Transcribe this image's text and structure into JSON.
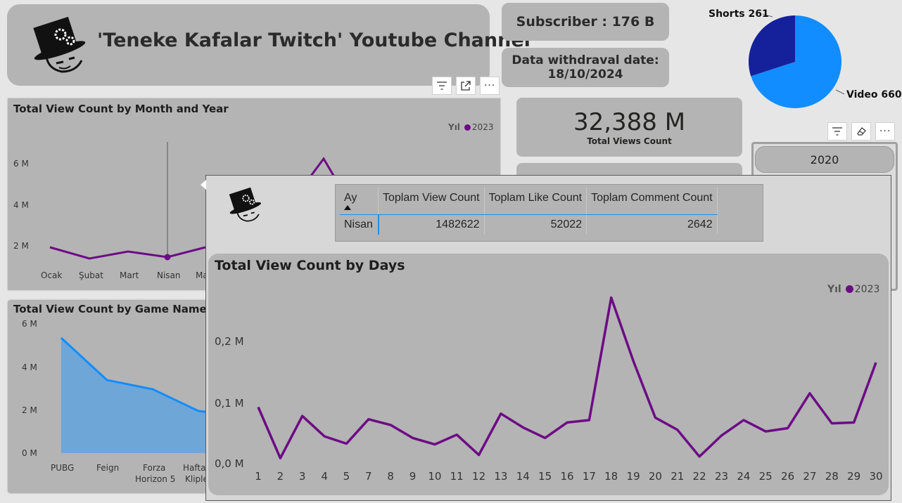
{
  "header": {
    "title": "'Teneke Kafalar Twitch' Youtube Channel",
    "logo_icon": "tin-head-gear-logo-icon"
  },
  "subscriber": {
    "label": "Subscriber : 176 B"
  },
  "withdraw": {
    "line1": "Data withdraval date:",
    "line2": "18/10/2024"
  },
  "total_views": {
    "value": "32,388 M",
    "label": "Total Views Count"
  },
  "pie": {
    "shorts_label": "Shorts 261",
    "video_label": "Video 660",
    "colors": {
      "shorts": "#14219a",
      "video": "#118dff"
    }
  },
  "slicer": {
    "year_value": "2020"
  },
  "visual_toolbar_icons": [
    "filter-icon",
    "focus-mode-icon",
    "more-options-icon",
    "eraser-icon"
  ],
  "month_chart": {
    "title": "Total View Count by Month and Year",
    "legend_title": "Yıl",
    "legend_item": "2023",
    "y_ticks": [
      "6 M",
      "4 M",
      "2 M"
    ],
    "x_ticks": [
      "Ocak",
      "Şubat",
      "Mart",
      "Nisan",
      "Ma"
    ]
  },
  "game_chart": {
    "title": "Total View Count by Game Name",
    "y_ticks": [
      "6 M",
      "4 M",
      "2 M",
      "0 M"
    ],
    "x_ticks": [
      "PUBG",
      "Feign",
      "Forza",
      "Horizon 5",
      "Haftar",
      "Kliple"
    ]
  },
  "tooltip": {
    "columns": [
      "Ay",
      "Toplam View Count",
      "Toplam Like Count",
      "Toplam Comment Count"
    ],
    "rows": [
      [
        "Nisan",
        "1482622",
        "52022",
        "2642"
      ]
    ]
  },
  "colors": {
    "line": "#6d0a85",
    "area_line": "#118dff",
    "area_fill": "#6fa6d8",
    "card_bg": "#b4b4b4",
    "page_bg": "#e6e6e6"
  },
  "chart_data": [
    {
      "type": "line",
      "title": "Total View Count by Days",
      "legend_title": "Yıl",
      "x": [
        1,
        2,
        3,
        4,
        5,
        6,
        7,
        8,
        9,
        10,
        11,
        12,
        13,
        14,
        15,
        16,
        17,
        18,
        19,
        20,
        21,
        22,
        23,
        24,
        25,
        26,
        27,
        28,
        29,
        30
      ],
      "x_tick_labels": [
        "1",
        "2",
        "3",
        "4",
        "5",
        "7",
        "8",
        "9",
        "10",
        "11",
        "12",
        "13",
        "14",
        "15",
        "16",
        "17",
        "18",
        "19",
        "20",
        "21",
        "22",
        "23",
        "24",
        "25",
        "26",
        "27",
        "28",
        "29",
        "30"
      ],
      "series": [
        {
          "name": "2023",
          "values": [
            0.068,
            0.005,
            0.057,
            0.032,
            0.023,
            0.053,
            0.046,
            0.03,
            0.022,
            0.034,
            0.009,
            0.06,
            0.043,
            0.03,
            0.049,
            0.052,
            0.203,
            0.125,
            0.055,
            0.04,
            0.007,
            0.033,
            0.052,
            0.038,
            0.042,
            0.085,
            0.048,
            0.049,
            0.123
          ]
        }
      ],
      "y_ticks": [
        "0,2 M",
        "0,1 M",
        "0,0 M"
      ],
      "ylim": [
        0,
        0.24
      ]
    },
    {
      "type": "line",
      "title": "Total View Count by Month and Year",
      "categories": [
        "Ocak",
        "Şubat",
        "Mart",
        "Nisan",
        "Ma"
      ],
      "series": [
        {
          "name": "2023",
          "values": [
            1.9,
            1.4,
            1.7,
            1.48,
            1.9
          ]
        }
      ],
      "ylim": [
        0,
        7
      ]
    },
    {
      "type": "area",
      "title": "Total View Count by Game Name",
      "categories": [
        "PUBG",
        "Feign",
        "Forza Horizon 5",
        "Haftar Kliple"
      ],
      "values": [
        5.4,
        3.4,
        3.0,
        2.0
      ],
      "ylim": [
        0,
        6
      ]
    }
  ]
}
